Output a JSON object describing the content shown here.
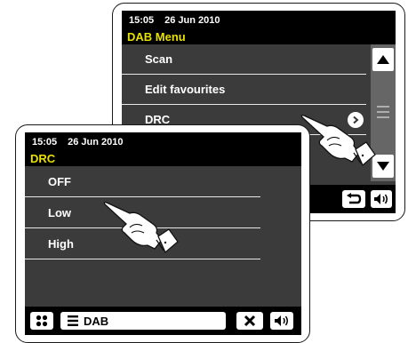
{
  "back_screen": {
    "time": "15:05",
    "date": "26 Jun 2010",
    "menu_title": "DAB Menu",
    "items": [
      {
        "label": "Scan"
      },
      {
        "label": "Edit favourites"
      },
      {
        "label": "DRC"
      }
    ]
  },
  "front_screen": {
    "time": "15:05",
    "date": "26 Jun 2010",
    "menu_title": "DRC",
    "items": [
      {
        "label": "OFF"
      },
      {
        "label": "Low"
      },
      {
        "label": "High"
      }
    ],
    "mode_label": "DAB"
  },
  "icons": {
    "up": "up-arrow-icon",
    "down": "down-arrow-icon",
    "back": "back-icon",
    "volume": "volume-icon",
    "home": "home-icon",
    "menu": "menu-lines-icon",
    "close": "close-icon",
    "chevron": "chevron-right-icon",
    "hand": "pointing-hand-icon"
  },
  "colors": {
    "screen_bg": "#3b3b3b",
    "title_text": "#e8e000",
    "scroll_track": "#666666"
  }
}
